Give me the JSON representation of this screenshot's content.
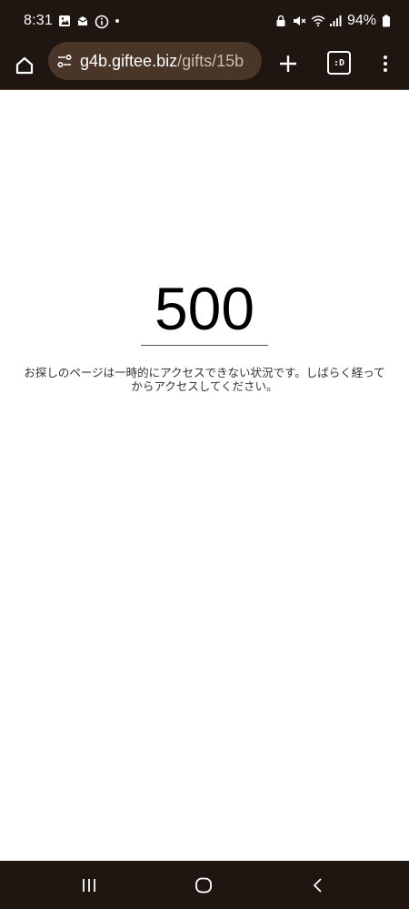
{
  "status_bar": {
    "time": "8:31",
    "battery": "94%",
    "left_icons": [
      "image-icon",
      "notification-icon",
      "info-icon",
      "dot-icon"
    ],
    "right_icons": [
      "lock-icon",
      "mute-icon",
      "wifi-icon",
      "signal-icon",
      "battery-icon"
    ]
  },
  "browser": {
    "url_host": "g4b.giftee.biz",
    "url_path": "/gifts/15b",
    "tab_label": ":D"
  },
  "page": {
    "error_code": "500",
    "message": "お探しのページは一時的にアクセスできない状況です。しばらく経ってからアクセスしてください。"
  },
  "colors": {
    "chrome_bg": "#1f1612",
    "url_bar_bg": "#4a3628",
    "page_bg": "#ffffff"
  }
}
